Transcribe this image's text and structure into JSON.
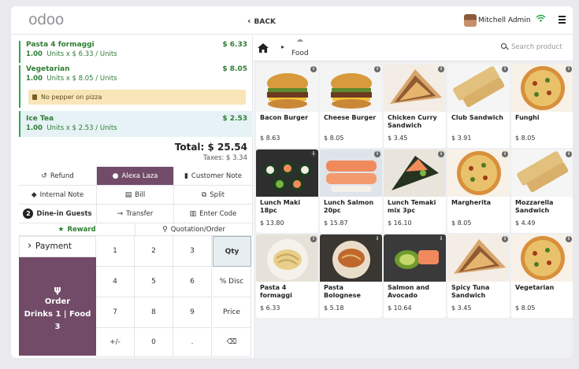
{
  "header": {
    "logo": "odoo",
    "back_label": "BACK",
    "user_name": "Mitchell Admin"
  },
  "order": {
    "lines": [
      {
        "name": "Pasta 4 formaggi",
        "qty": "1.00",
        "unit_text": "Units x $ 6.33 / Units",
        "price": "$ 6.33"
      },
      {
        "name": "Vegetarian",
        "qty": "1.00",
        "unit_text": "Units x $ 8.05 / Units",
        "price": "$ 8.05",
        "note": "No pepper on pizza"
      },
      {
        "name": "Ice Tea",
        "qty": "1.00",
        "unit_text": "Units x $ 2.53 / Units",
        "price": "$ 2.53",
        "selected": true
      }
    ],
    "total": "Total: $ 25.54",
    "taxes": "Taxes: $ 3.34"
  },
  "controls": {
    "refund": "Refund",
    "customer": "Alexa Laza",
    "customer_note": "Customer Note",
    "internal_note": "Internal Note",
    "bill": "Bill",
    "split": "Split",
    "guests_count": "2",
    "guests_label": "Dine-in Guests",
    "transfer": "Transfer",
    "enter_code": "Enter Code",
    "reward": "Reward",
    "quotation": "Quotation/Order"
  },
  "payment_label": "Payment",
  "order_button": {
    "title": "Order",
    "line2": "Drinks 1 | Food",
    "line3": "3"
  },
  "numpad": [
    "1",
    "2",
    "3",
    "Qty",
    "4",
    "5",
    "6",
    "% Disc",
    "7",
    "8",
    "9",
    "Price",
    "+/-",
    "0",
    ".",
    "⌫"
  ],
  "category": {
    "current": "Food"
  },
  "search": {
    "placeholder": "Search product"
  },
  "products": [
    {
      "name": "Bacon Burger",
      "price": "$ 8.63",
      "thumb": "burger"
    },
    {
      "name": "Cheese Burger",
      "price": "$ 8.05",
      "thumb": "burger"
    },
    {
      "name": "Chicken Curry Sandwich",
      "price": "$ 3.45",
      "thumb": "sandwich"
    },
    {
      "name": "Club Sandwich",
      "price": "$ 3.91",
      "thumb": "wrap"
    },
    {
      "name": "Funghi",
      "price": "$ 8.05",
      "thumb": "pizza"
    },
    {
      "name": "Lunch Maki 18pc",
      "price": "$ 13.80",
      "thumb": "sushi"
    },
    {
      "name": "Lunch Salmon 20pc",
      "price": "$ 15.87",
      "thumb": "salmon"
    },
    {
      "name": "Lunch Temaki mix 3pc",
      "price": "$ 16.10",
      "thumb": "temaki"
    },
    {
      "name": "Margherita",
      "price": "$ 8.05",
      "thumb": "pizza"
    },
    {
      "name": "Mozzarella Sandwich",
      "price": "$ 4.49",
      "thumb": "wrap"
    },
    {
      "name": "Pasta 4 formaggi",
      "price": "$ 6.33",
      "thumb": "pasta"
    },
    {
      "name": "Pasta Bolognese",
      "price": "$ 5.18",
      "thumb": "bolognese"
    },
    {
      "name": "Salmon and Avocado",
      "price": "$ 10.64",
      "thumb": "avocado"
    },
    {
      "name": "Spicy Tuna Sandwich",
      "price": "$ 3.45",
      "thumb": "sandwich"
    },
    {
      "name": "Vegetarian",
      "price": "$ 8.05",
      "thumb": "pizza"
    }
  ],
  "colors": {
    "brand": "#714b67",
    "line_green": "#2e7d32",
    "selected_line": "#e6f2f5",
    "note_bg": "#f8e5b8"
  }
}
